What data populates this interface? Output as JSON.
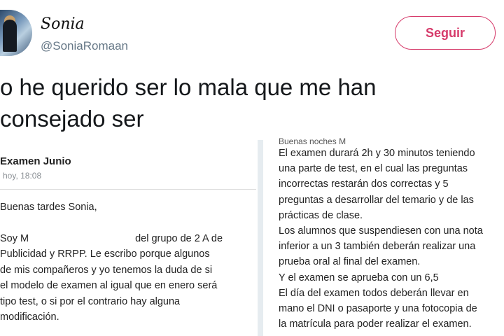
{
  "user": {
    "display_name": "Sonia",
    "handle": "@SoniaRomaan"
  },
  "follow_button": {
    "label": "Seguir"
  },
  "tweet": {
    "lines": [
      "o he querido ser lo mala que me han",
      "consejado ser"
    ]
  },
  "email": {
    "subject": "Examen Junio",
    "date": "hoy, 18:08",
    "greeting": "Buenas tardes Sonia,",
    "line1a": "Soy M",
    "line1b": "del grupo de 2 A de",
    "lines": [
      "Publicidad y RRPP.  Le escribo porque algunos",
      "de mis compañeros y yo tenemos la duda de si",
      "el modelo de examen al igual que en enero será",
      "tipo test, o si por el contrario hay alguna",
      "modificación."
    ]
  },
  "reply": {
    "cut_line": "Buenas noches M",
    "lines": [
      "El examen durará 2h y 30 minutos teniendo",
      "una parte de test, en el cual las preguntas",
      "incorrectas restarán dos correctas y 5",
      "preguntas a desarrollar del temario y de las",
      "prácticas de clase.",
      "Los alumnos que suspendiesen con una nota",
      "inferior a un 3 también deberán realizar una",
      "prueba oral al final del examen.",
      "Y el examen se aprueba con un 6,5",
      "El día del examen todos deberán llevar en",
      "mano el DNI o pasaporte y una fotocopia de",
      "la matrícula para poder realizar el examen."
    ]
  }
}
